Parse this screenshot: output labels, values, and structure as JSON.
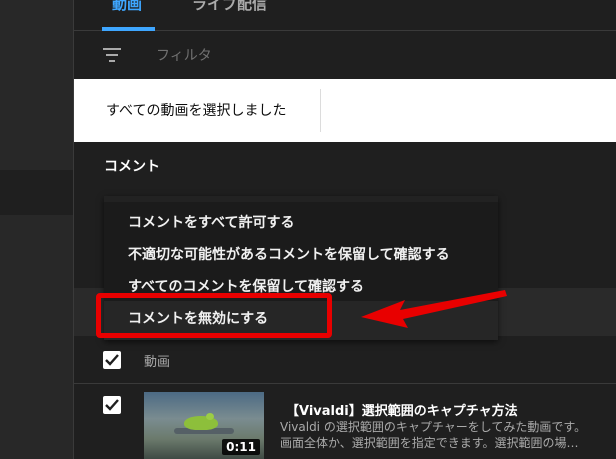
{
  "tabs": {
    "videos": "動画",
    "live": "ライブ配信"
  },
  "filter": {
    "icon": "filter-icon",
    "placeholder": "フィルタ"
  },
  "selection": {
    "status": "すべての動画を選択しました"
  },
  "comments": {
    "title": "コメント",
    "options": [
      "コメントをすべて許可する",
      "不適切な可能性があるコメントを保留して確認する",
      "すべてのコメントを保留して確認する",
      "コメントを無効にする"
    ],
    "highlighted_option": "コメントを無効にする"
  },
  "table": {
    "header_label": "動画",
    "rows": [
      {
        "title": "【Vivaldi】選択範囲のキャプチャ方法",
        "description_line1": "Vivaldi の選択範囲のキャプチャーをしてみた動画です。",
        "description_line2": "画面全体か、選択範囲を指定できます。選択範囲の場…",
        "duration": "0:11"
      }
    ]
  },
  "colors": {
    "accent": "#3ea6ff",
    "annotation": "#e80000",
    "background": "#1f1f1f"
  }
}
